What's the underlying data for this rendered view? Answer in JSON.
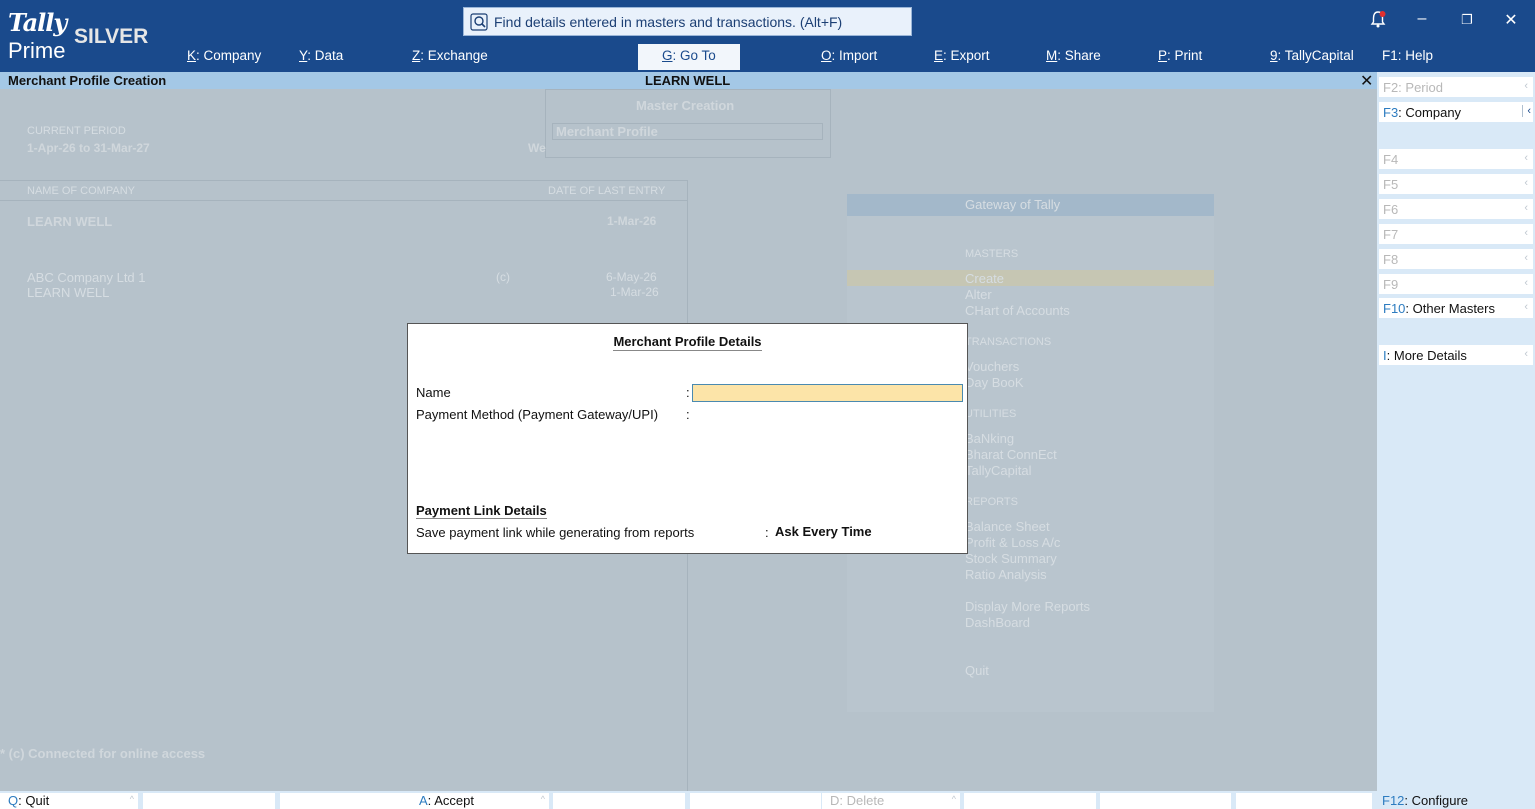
{
  "app": {
    "logo_top": "Tally",
    "logo_bottom": "Prime",
    "edition": "SILVER"
  },
  "search": {
    "text": "Find details entered in masters and transactions. (Alt+F)"
  },
  "window_controls": {
    "minimize": "–",
    "restore": "❐",
    "close": "✕"
  },
  "top_menu": [
    {
      "key": "K",
      "label": "Company"
    },
    {
      "key": "Y",
      "label": "Data"
    },
    {
      "key": "Z",
      "label": "Exchange"
    },
    {
      "key": "G",
      "label": "Go To"
    },
    {
      "key": "O",
      "label": "Import"
    },
    {
      "key": "E",
      "label": "Export"
    },
    {
      "key": "M",
      "label": "Share"
    },
    {
      "key": "P",
      "label": "Print"
    },
    {
      "key": "9",
      "label": "TallyCapital"
    },
    {
      "key": "F1",
      "label": "Help"
    }
  ],
  "title_bar": {
    "screen": "Merchant Profile Creation",
    "company": "LEARN WELL",
    "close": "✕"
  },
  "background": {
    "master_creation": "Master Creation",
    "master_field": "Merchant Profile",
    "current_period_label": "CURRENT PERIOD",
    "current_period": "1-Apr-26 to 31-Mar-27",
    "current_date_partial": "We",
    "name_of_company_label": "NAME OF COMPANY",
    "date_of_last_entry_label": "DATE OF LAST ENTRY",
    "company_name": "LEARN WELL",
    "company_last_entry": "1-Mar-26",
    "companies": [
      {
        "name": "ABC Company Ltd 1",
        "flag": "(c)",
        "date": "6-May-26"
      },
      {
        "name": "LEARN WELL",
        "flag": "",
        "date": "1-Mar-26"
      }
    ],
    "connected_note": "* (c) Connected for online access",
    "gateway": {
      "title": "Gateway of Tally",
      "sections": [
        {
          "head": "MASTERS",
          "items": [
            "Create",
            "Alter",
            "CHart of Accounts"
          ]
        },
        {
          "head": "TRANSACTIONS",
          "items": [
            "Vouchers",
            "Day BooK"
          ]
        },
        {
          "head": "UTILITIES",
          "items": [
            "BaNking",
            "Bharat ConnEct",
            "TallyCapital"
          ]
        },
        {
          "head": "REPORTS",
          "items": [
            "Balance Sheet",
            "Profit & Loss A/c",
            "Stock Summary",
            "Ratio Analysis"
          ]
        }
      ],
      "more": [
        "Display More Reports",
        "DashBoard"
      ],
      "quit": "Quit"
    }
  },
  "dialog": {
    "title": "Merchant Profile Details",
    "name_label": "Name",
    "name_value": "",
    "payment_method_label": "Payment Method (Payment Gateway/UPI)",
    "payment_link_heading": "Payment Link Details",
    "save_link_label": "Save payment link while generating from reports",
    "save_link_value": "Ask Every Time",
    "colon": ":"
  },
  "right_panel": [
    {
      "key": "F2",
      "label": "Period",
      "disabled": true
    },
    {
      "key": "F3",
      "label": "Company",
      "disabled": false
    },
    {
      "key": "F4",
      "label": "",
      "disabled": true
    },
    {
      "key": "F5",
      "label": "",
      "disabled": true
    },
    {
      "key": "F6",
      "label": "",
      "disabled": true
    },
    {
      "key": "F7",
      "label": "",
      "disabled": true
    },
    {
      "key": "F8",
      "label": "",
      "disabled": true
    },
    {
      "key": "F9",
      "label": "",
      "disabled": true
    },
    {
      "key": "F10",
      "label": "Other Masters",
      "disabled": false
    },
    {
      "key": "I",
      "label": "More Details",
      "disabled": false
    }
  ],
  "bottom_bar": [
    {
      "key": "Q",
      "label": "Quit",
      "disabled": false
    },
    {
      "key": "A",
      "label": "Accept",
      "disabled": false
    },
    {
      "key": "D",
      "label": "Delete",
      "disabled": true
    },
    {
      "key": "F12",
      "label": "Configure",
      "disabled": false
    }
  ],
  "colors": {
    "topbar": "#1a4a8c",
    "titlebar": "#a4c8e6",
    "input_highlight": "#fce4a8",
    "key_accent": "#2d7cc0"
  }
}
